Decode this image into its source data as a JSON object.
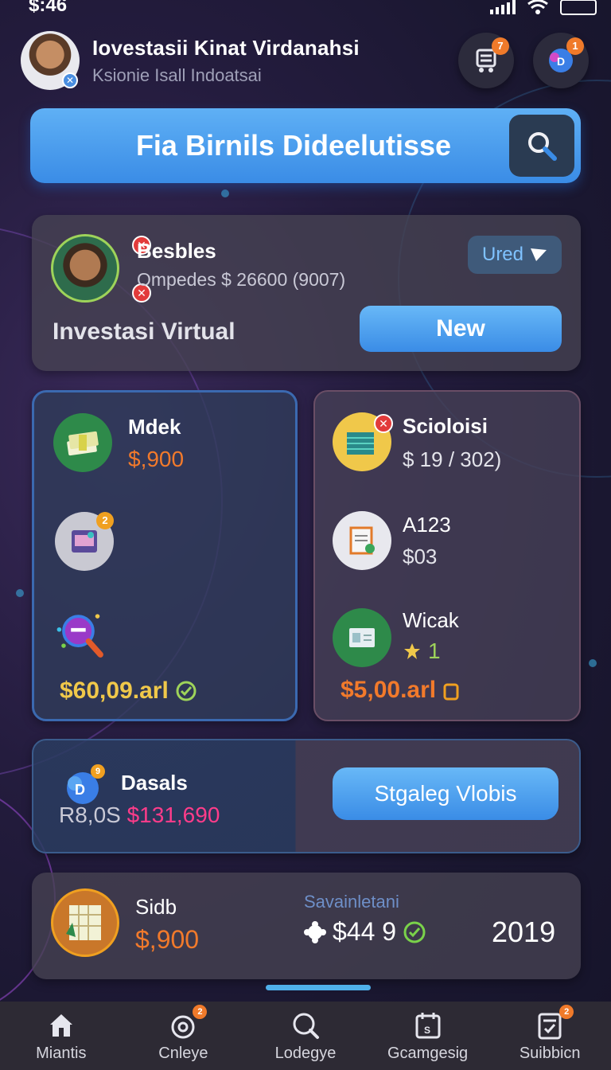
{
  "status_bar": {
    "time": "$:46"
  },
  "header": {
    "title": "Iovestasii Kinat Virdanahsi",
    "subtitle": "Ksionie Isall Indoatsai",
    "cart_badge": "7",
    "chat_badge": "1"
  },
  "search": {
    "label": "Fia Birnils Dideelutisse"
  },
  "profile_card": {
    "name": "Besbles",
    "detail": "Ompedes $ 26600 (9007)",
    "section_label": "Investasi Virtual",
    "used_button": "Ured",
    "new_button": "New"
  },
  "left_card": {
    "item1_title": "Mdek",
    "item1_value": "$,900",
    "item2_badge": "2",
    "total": "$60,09.arl"
  },
  "right_card": {
    "item1_title": "Scioloisi",
    "item1_value": "$ 19 / 302)",
    "item2_title": "A123",
    "item2_value": "$03",
    "item3_title": "Wicak",
    "item3_value": "1",
    "total": "$5,00.arl"
  },
  "dasals_card": {
    "title": "Dasals",
    "prefix": "R8,0S",
    "amount": "$131,690",
    "button": "Stgaleg Vlobis",
    "icon_badge": "9"
  },
  "sidb_card": {
    "title": "Sidb",
    "value": "$,900",
    "savings_label": "Savainletani",
    "savings_value": "$44 9",
    "year": "2019"
  },
  "tabs": [
    {
      "label": "Miantis",
      "badge": ""
    },
    {
      "label": "Cnleye",
      "badge": "2"
    },
    {
      "label": "Lodegye",
      "badge": ""
    },
    {
      "label": "Gcamgesig",
      "badge": ""
    },
    {
      "label": "Suibbicn",
      "badge": "2"
    }
  ],
  "colors": {
    "accent_blue": "#3a8ce6",
    "accent_orange": "#f27a2b",
    "accent_pink": "#ff3c8a",
    "total_yellow": "#f0c84a"
  }
}
